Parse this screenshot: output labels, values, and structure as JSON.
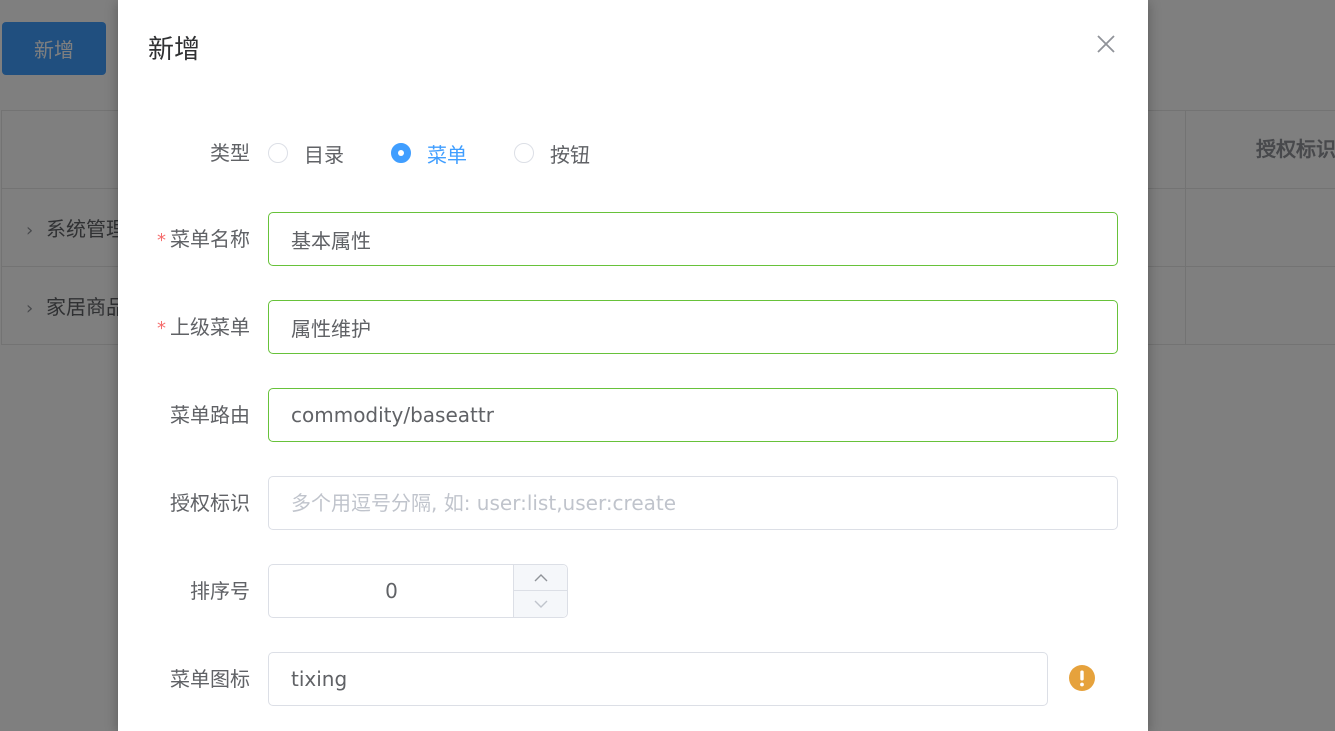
{
  "background": {
    "add_button_label": "新增",
    "table_header_auth": "授权标识",
    "rows": [
      "系统管理",
      "家居商品"
    ]
  },
  "dialog": {
    "title": "新增",
    "form": {
      "type": {
        "label": "类型",
        "options": [
          "目录",
          "菜单",
          "按钮"
        ],
        "selected": "菜单"
      },
      "menu_name": {
        "label": "菜单名称",
        "required": true,
        "value": "基本属性"
      },
      "parent_menu": {
        "label": "上级菜单",
        "required": true,
        "value": "属性维护"
      },
      "menu_route": {
        "label": "菜单路由",
        "value": "commodity/baseattr"
      },
      "permission": {
        "label": "授权标识",
        "value": "",
        "placeholder": "多个用逗号分隔, 如: user:list,user:create"
      },
      "sort_order": {
        "label": "排序号",
        "value": "0"
      },
      "menu_icon": {
        "label": "菜单图标",
        "value": "tixing",
        "status_icon": "warning-icon"
      }
    }
  },
  "colors": {
    "primary": "#409eff",
    "success_border": "#67c23a",
    "required": "#f56c6c",
    "warning": "#e6a23c"
  }
}
